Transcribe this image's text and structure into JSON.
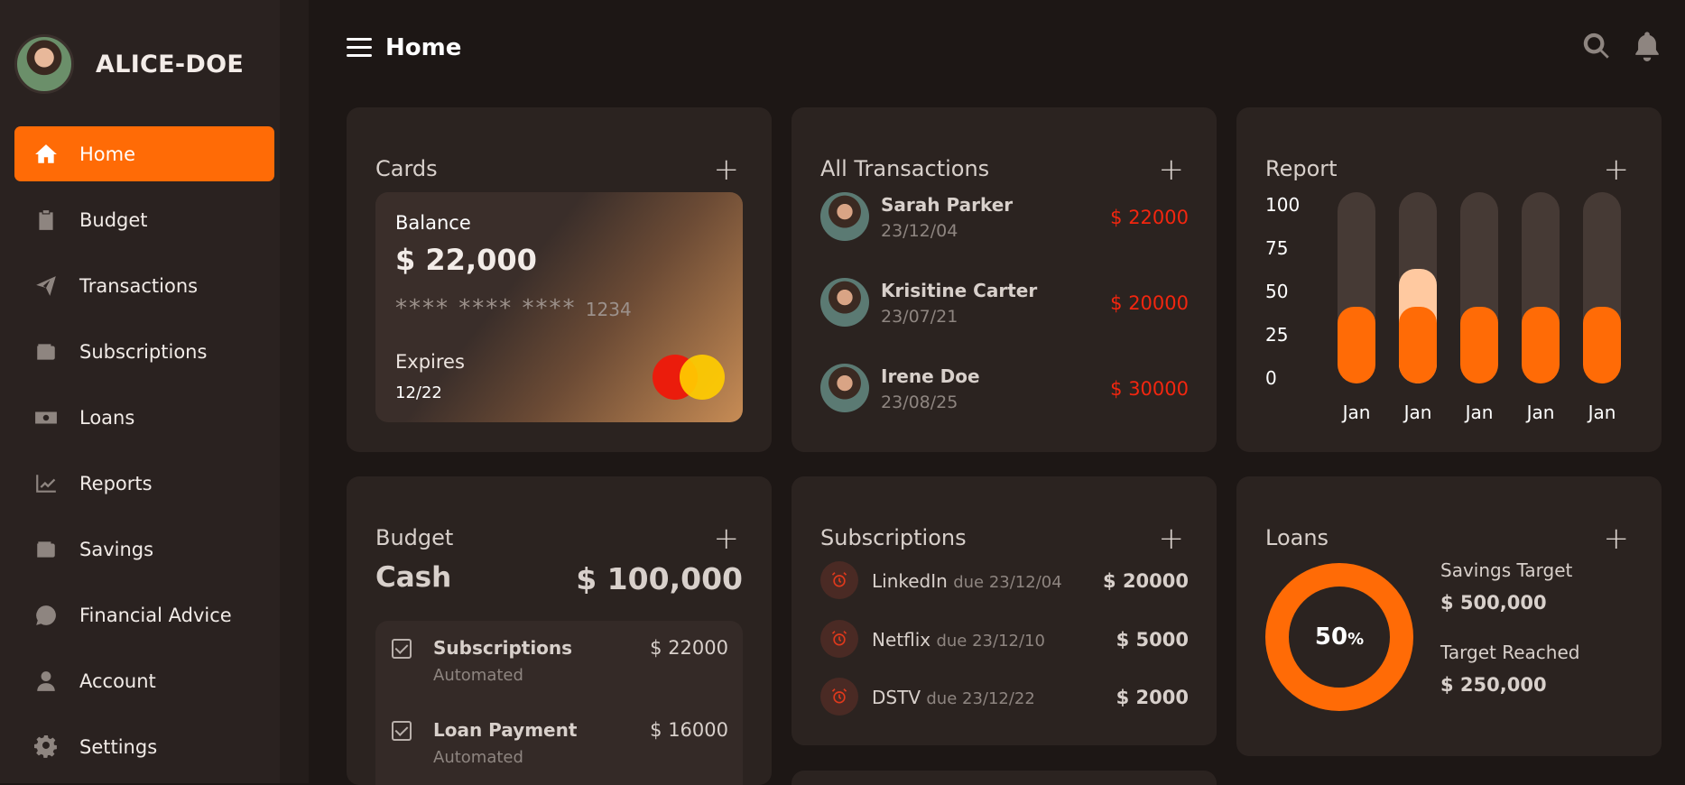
{
  "user": {
    "name": "ALICE-DOE"
  },
  "nav": [
    {
      "label": "Home",
      "icon": "home-icon",
      "active": true
    },
    {
      "label": "Budget",
      "icon": "clipboard-icon"
    },
    {
      "label": "Transactions",
      "icon": "paper-plane-icon"
    },
    {
      "label": "Subscriptions",
      "icon": "wallet-icon"
    },
    {
      "label": "Loans",
      "icon": "money-bill-icon"
    },
    {
      "label": "Reports",
      "icon": "chart-line-icon"
    },
    {
      "label": "Savings",
      "icon": "wallet-icon"
    },
    {
      "label": "Financial Advice",
      "icon": "dollar-chat-icon"
    },
    {
      "label": "Account",
      "icon": "user-icon"
    },
    {
      "label": "Settings",
      "icon": "gear-icon"
    }
  ],
  "header": {
    "title": "Home"
  },
  "colors": {
    "accent": "#ff6b06",
    "negative": "#f2260f",
    "background": "#1d1715",
    "card": "#2b2320"
  },
  "cards": {
    "title": "Cards",
    "balance_label": "Balance",
    "balance": "$ 22,000",
    "number_mask": "**** **** ****",
    "number_last": "1234",
    "expires_label": "Expires",
    "expires": "12/22",
    "brand_icon": "mastercard-icon"
  },
  "transactions": {
    "title": "All Transactions",
    "items": [
      {
        "name": "Sarah Parker",
        "date": "23/12/04",
        "amount": "$ 22000"
      },
      {
        "name": "Krisitine Carter",
        "date": "23/07/21",
        "amount": "$ 20000"
      },
      {
        "name": "Irene Doe",
        "date": "23/08/25",
        "amount": "$ 30000"
      }
    ]
  },
  "report": {
    "title": "Report"
  },
  "chart_data": {
    "type": "bar",
    "categories": [
      "Jan",
      "Jan",
      "Jan",
      "Jan",
      "Jan"
    ],
    "series": [
      {
        "values": [
          40,
          40,
          40,
          40,
          40
        ]
      },
      {
        "values": [
          0,
          20,
          0,
          0,
          0
        ]
      }
    ],
    "yticks": [
      "100",
      "75",
      "50",
      "25",
      "0"
    ],
    "ylim": [
      0,
      100
    ],
    "stacked": true
  },
  "budget": {
    "title": "Budget",
    "cash_label": "Cash",
    "total": "$ 100,000",
    "items": [
      {
        "name": "Subscriptions",
        "sub": "Automated",
        "amount": "$ 22000"
      },
      {
        "name": "Loan Payment",
        "sub": "Automated",
        "amount": "$ 16000"
      }
    ]
  },
  "subscriptions": {
    "title": "Subscriptions",
    "items": [
      {
        "name": "LinkedIn",
        "due": "due 23/12/04",
        "amount": "$ 20000"
      },
      {
        "name": "Netflix",
        "due": "due 23/12/10",
        "amount": "$ 5000"
      },
      {
        "name": "DSTV",
        "due": "due 23/12/22",
        "amount": "$ 2000"
      }
    ]
  },
  "loans": {
    "title": "Loans",
    "percent": "50",
    "percent_sign": "%",
    "savings_target_label": "Savings Target",
    "savings_target": "$ 500,000",
    "target_reached_label": "Target Reached",
    "target_reached": "$ 250,000"
  }
}
